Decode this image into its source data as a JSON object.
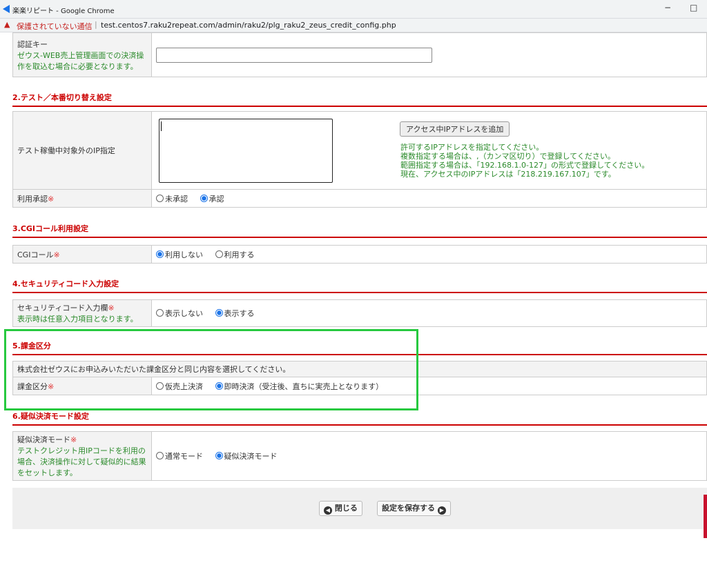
{
  "window": {
    "title": "楽楽リピート - Google Chrome",
    "minimize": "−",
    "maximize": "□"
  },
  "address": {
    "warning": "保護されていない通信",
    "sep": "|",
    "url": "test.centos7.raku2repeat.com/admin/raku2/plg_raku2_zeus_credit_config.php"
  },
  "auth": {
    "label": "認証キー",
    "note": "ゼウス-WEB売上管理画面での決済操作を取込む場合に必要となります。"
  },
  "sec2": {
    "title": "2.テスト／本番切り替え設定",
    "ip_label": "テスト稼働中対象外のIP指定",
    "add_btn": "アクセス中IPアドレスを追加",
    "help": [
      "許可するIPアドレスを指定してください。",
      "複数指定する場合は、,（カンマ区切り）で登録してください。",
      "範囲指定する場合は、「192.168.1.0-127」の形式で登録してください。",
      "現在、アクセス中のIPアドレスは「218.219.167.107」です。"
    ],
    "approve_label": "利用承認",
    "req": "※",
    "opt1": "未承認",
    "opt2": "承認"
  },
  "sec3": {
    "title": "3.CGIコール利用設定",
    "label": "CGIコール",
    "req": "※",
    "opt1": "利用しない",
    "opt2": "利用する"
  },
  "sec4": {
    "title": "4.セキュリティコード入力設定",
    "label": "セキュリティコード入力欄",
    "req": "※",
    "note": "表示時は任意入力項目となります。",
    "opt1": "表示しない",
    "opt2": "表示する"
  },
  "sec5": {
    "title": "5.課金区分",
    "desc": "株式会社ゼウスにお申込みいただいた課金区分と同じ内容を選択してください。",
    "label": "課金区分",
    "req": "※",
    "opt1": "仮売上決済",
    "opt2": "即時決済（受注後、直ちに実売上となります）"
  },
  "sec6": {
    "title": "6.疑似決済モード設定",
    "label": "疑似決済モード",
    "req": "※",
    "note": "テストクレジット用IPコードを利用の場合、決済操作に対して疑似的に結果をセットします。",
    "opt1": "通常モード",
    "opt2": "疑似決済モード"
  },
  "footer": {
    "close": "閉じる",
    "save": "設定を保存する"
  }
}
